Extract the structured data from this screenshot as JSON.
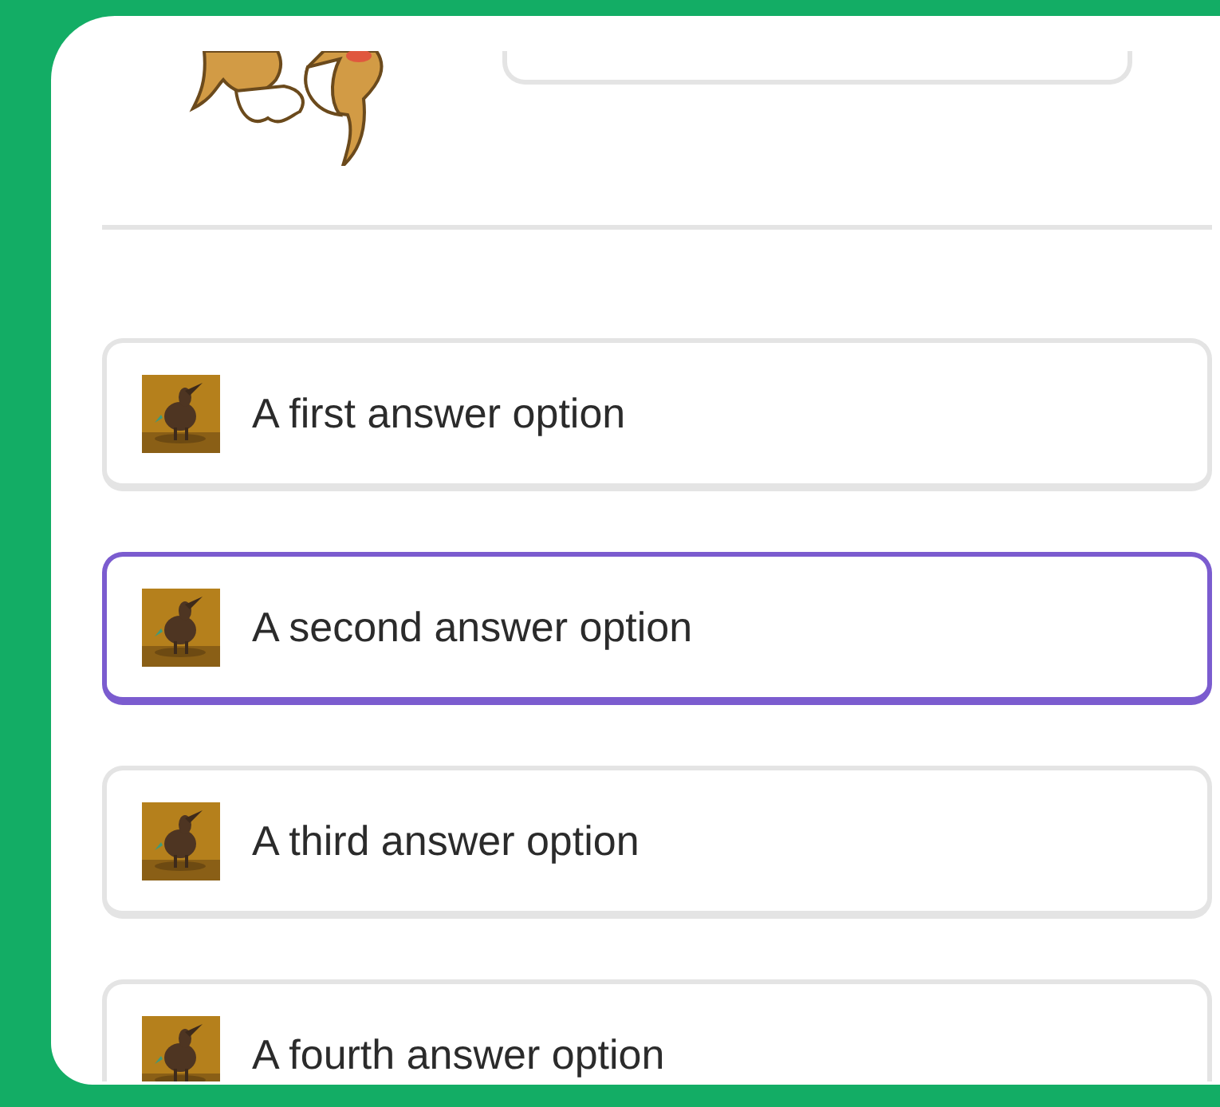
{
  "options": [
    {
      "label": "A first answer option",
      "selected": false
    },
    {
      "label": "A second answer option",
      "selected": true
    },
    {
      "label": "A third answer option",
      "selected": false
    },
    {
      "label": "A fourth answer option",
      "selected": false
    }
  ]
}
